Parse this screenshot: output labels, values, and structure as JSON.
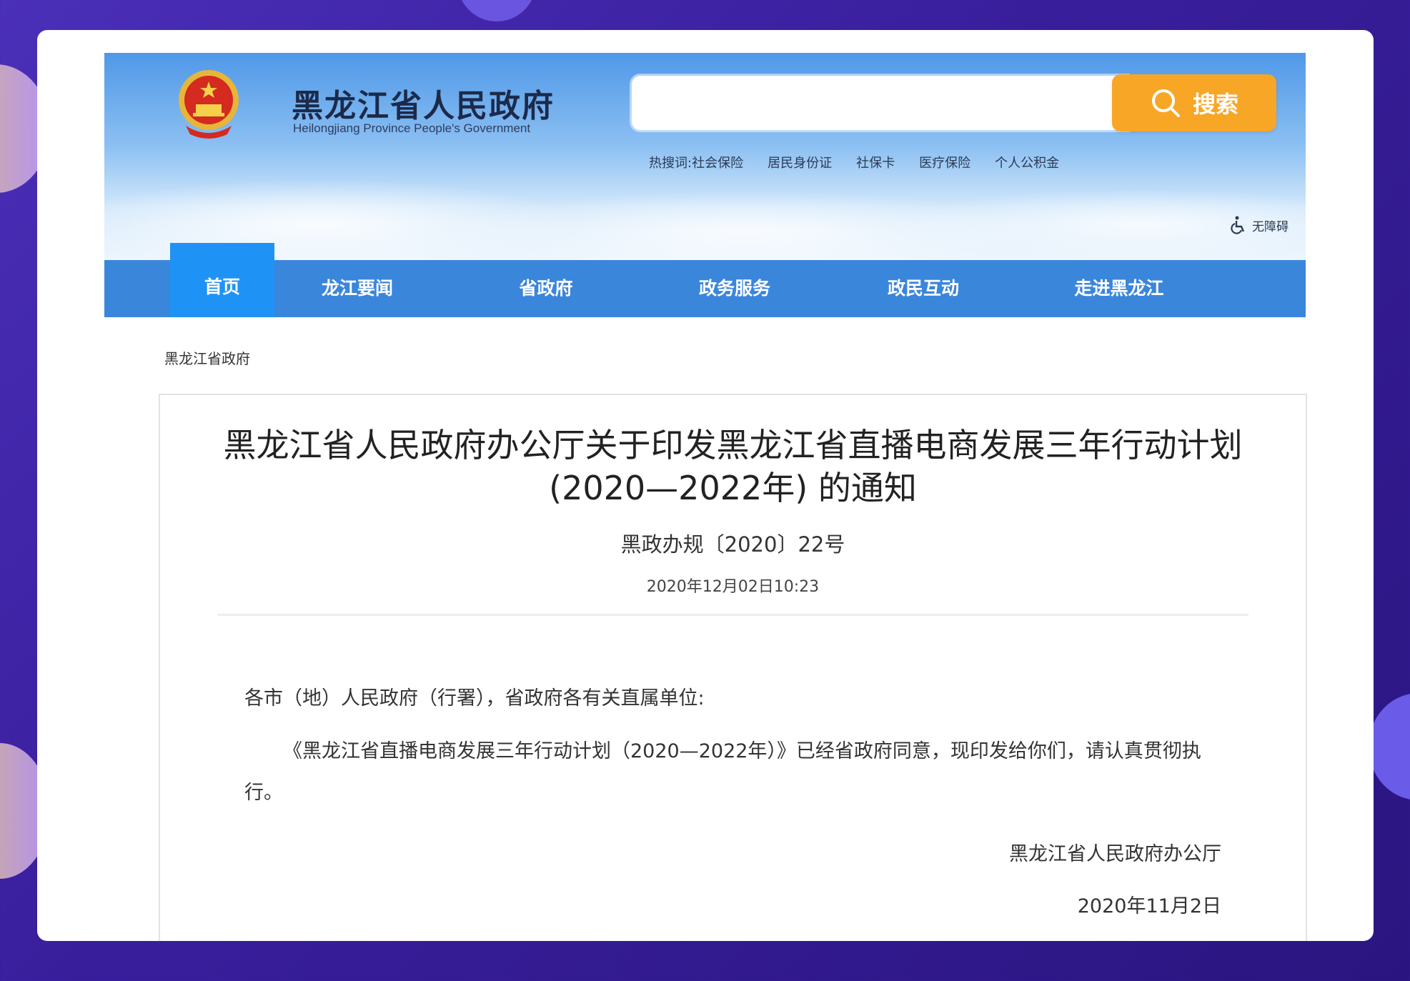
{
  "header": {
    "site_title": "黑龙江省人民政府",
    "site_subtitle": "Heilongjiang Province People's Government",
    "search": {
      "placeholder": "",
      "button_label": "搜索"
    },
    "hotwords_label": "热搜词:",
    "hotwords": [
      "社会保险",
      "居民身份证",
      "社保卡",
      "医疗保险",
      "个人公积金"
    ],
    "accessibility_label": "无障碍"
  },
  "nav": {
    "items": [
      "首页",
      "龙江要闻",
      "省政府",
      "政务服务",
      "政民互动",
      "走进黑龙江"
    ],
    "active": "首页"
  },
  "breadcrumb": "黑龙江省政府",
  "article": {
    "title": "黑龙江省人民政府办公厅关于印发黑龙江省直播电商发展三年行动计划 (2020—2022年) 的通知",
    "doc_number": "黑政办规〔2020〕22号",
    "publish_time": "2020年12月02日10:23",
    "salutation": "各市（地）人民政府（行署），省政府各有关直属单位:",
    "body": "《黑龙江省直播电商发展三年行动计划（2020—2022年）》已经省政府同意，现印发给你们，请认真贯彻执行。",
    "signature": "黑龙江省人民政府办公厅",
    "date": "2020年11月2日"
  },
  "colors": {
    "background": "#3a1f9e",
    "nav": "#3a86db",
    "nav_active": "#1f93f5",
    "search_button": "#f8a626"
  }
}
